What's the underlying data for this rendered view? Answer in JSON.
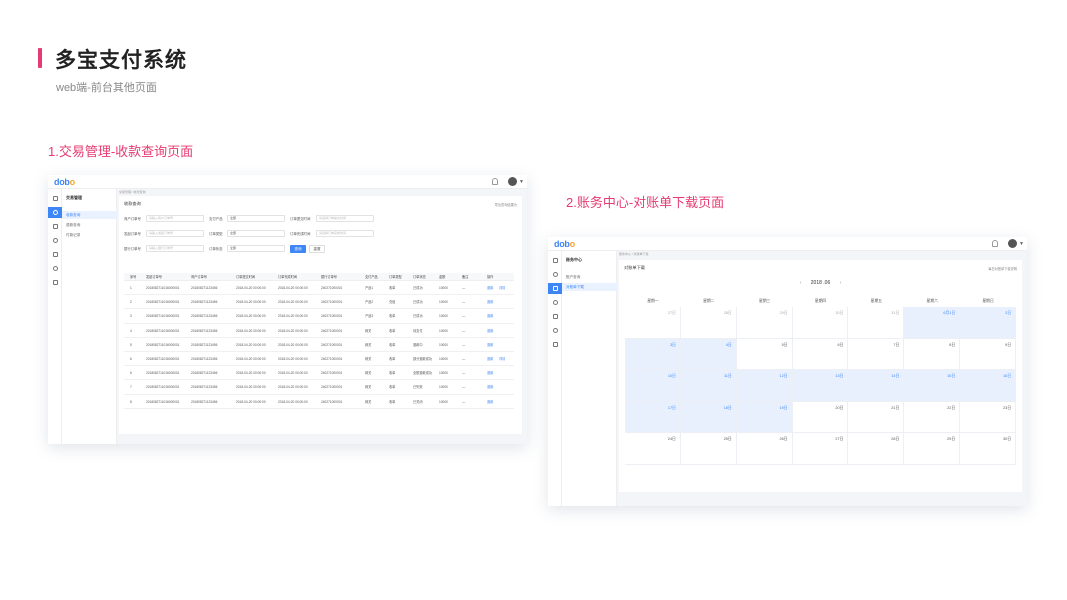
{
  "page": {
    "title": "多宝支付系统",
    "subtitle": "web端-前台其他页面",
    "accent_color": "#e63b72",
    "brand_color": "#3e86f5"
  },
  "section1": {
    "title": "1.交易管理-收款查询页面",
    "logo": {
      "main": "dob",
      "accent": "o"
    },
    "icons": [
      "home-icon",
      "transaction-icon",
      "file-icon",
      "user-icon",
      "settings-icon",
      "shield-icon",
      "share-icon"
    ],
    "subnav": {
      "title": "交易管理",
      "items": [
        "收款查询",
        "退款查询",
        "付款记录"
      ]
    },
    "breadcrumb": "交易管理 / 收款查询",
    "card_title": "收款查询",
    "export_link": "导出查询结果为",
    "form": {
      "row1": [
        {
          "label": "商户订单号",
          "placeholder": "请输入商户订单号"
        },
        {
          "label": "支付产品",
          "value": "全部"
        },
        {
          "label": "订单提交时间",
          "placeholder": "请选择订单提交时间"
        }
      ],
      "row2": [
        {
          "label": "发起订单号",
          "placeholder": "请输入发起订单号"
        },
        {
          "label": "订单类型",
          "value": "全部"
        },
        {
          "label": "订单完成时间",
          "placeholder": "请选择订单完成时间"
        }
      ],
      "row3": [
        {
          "label": "银行订单号",
          "placeholder": "请输入银行订单号"
        },
        {
          "label": "订单状态",
          "value": "全部"
        }
      ],
      "search_label": "查询",
      "reset_label": "重置"
    },
    "table": {
      "headers": [
        "序号",
        "发起订单号",
        "商户订单号",
        "订单提交时间",
        "订单完成时间",
        "银行订单号",
        "支付产品",
        "订单类型",
        "订单状态",
        "金额",
        "备注",
        "操作"
      ],
      "rows": [
        {
          "no": "1",
          "req": "2018082711016000001",
          "mch": "201808271123456",
          "submit": "2018-04-20 00:00:00",
          "done": "2018-04-20 00:00:00",
          "bank": "240271000001",
          "product": "产品1",
          "type": "收单",
          "status": "已成功",
          "amount": "10000",
          "note": "—",
          "ops": [
            "退款",
            "详情"
          ]
        },
        {
          "no": "2",
          "req": "2018082711016000001",
          "mch": "201808271123456",
          "submit": "2018-04-20 00:00:00",
          "done": "2018-04-20 00:00:00",
          "bank": "240271000001",
          "product": "产品2",
          "type": "充值",
          "status": "已成功",
          "amount": "10000",
          "note": "—",
          "ops": [
            "退款"
          ]
        },
        {
          "no": "3",
          "req": "2018082711016000001",
          "mch": "201808271123456",
          "submit": "2018-04-20 00:00:00",
          "done": "2018-04-20 00:00:00",
          "bank": "240271000001",
          "product": "产品3",
          "type": "收单",
          "status": "已成功",
          "amount": "10000",
          "note": "—",
          "ops": [
            "退款"
          ]
        },
        {
          "no": "4",
          "req": "2018082711016000001",
          "mch": "201808271123456",
          "submit": "2018-04-20 00:00:00",
          "done": "2018-04-20 00:00:00",
          "bank": "240271000001",
          "product": "网关",
          "type": "收单",
          "status": "待支付",
          "amount": "10000",
          "note": "—",
          "ops": [
            "退款"
          ]
        },
        {
          "no": "5",
          "req": "2018082711016000001",
          "mch": "201808271123456",
          "submit": "2018-04-20 00:00:00",
          "done": "2018-04-20 00:00:00",
          "bank": "240271000001",
          "product": "网关",
          "type": "收单",
          "status": "退款中",
          "amount": "10000",
          "note": "—",
          "ops": [
            "退款"
          ]
        },
        {
          "no": "6",
          "req": "2018082711016000001",
          "mch": "201808271123456",
          "submit": "2018-04-20 00:00:00",
          "done": "2018-04-20 00:00:00",
          "bank": "240271000001",
          "product": "网关",
          "type": "收单",
          "status": "部分退款成功",
          "amount": "10000",
          "note": "—",
          "ops": [
            "退款",
            "详情"
          ]
        },
        {
          "no": "6",
          "req": "2018082711016000001",
          "mch": "201808271123456",
          "submit": "2018-04-20 00:00:00",
          "done": "2018-04-20 00:00:00",
          "bank": "240271000001",
          "product": "网关",
          "type": "收单",
          "status": "全额退款成功",
          "amount": "10000",
          "note": "—",
          "ops": [
            "退款"
          ]
        },
        {
          "no": "7",
          "req": "2018082711016000001",
          "mch": "201808271123456",
          "submit": "2018-04-20 00:00:00",
          "done": "2018-04-20 00:00:00",
          "bank": "240271000001",
          "product": "网关",
          "type": "收单",
          "status": "已失败",
          "amount": "10000",
          "note": "—",
          "ops": [
            "退款"
          ]
        },
        {
          "no": "8",
          "req": "2018082711016000001",
          "mch": "201808271123456",
          "submit": "2018-04-20 00:00:00",
          "done": "2018-04-20 00:00:00",
          "bank": "240271000001",
          "product": "网关",
          "type": "收单",
          "status": "已关闭",
          "amount": "10000",
          "note": "—",
          "ops": [
            "退款"
          ]
        }
      ]
    }
  },
  "section2": {
    "title": "2.账务中心-对账单下载页面",
    "logo": {
      "main": "dob",
      "accent": "o"
    },
    "icons": [
      "home-icon",
      "transaction-icon",
      "file-icon",
      "user-icon",
      "settings-icon",
      "shield-icon",
      "share-icon"
    ],
    "subnav": {
      "title": "账务中心",
      "items": [
        "账户查询",
        "对账单下载"
      ]
    },
    "breadcrumb": "账务中心 / 对账单下载",
    "card_title": "对账单下载",
    "download_link": "每日对账单下载说明",
    "month": "2018 .06",
    "prev": "‹",
    "next": "›",
    "weekdays": [
      "星期一",
      "星期二",
      "星期三",
      "星期四",
      "星期五",
      "星期六",
      "星期日"
    ],
    "days": [
      {
        "label": "27日",
        "muted": true
      },
      {
        "label": "28日",
        "muted": true
      },
      {
        "label": "29日",
        "muted": true
      },
      {
        "label": "30日",
        "muted": true
      },
      {
        "label": "31日",
        "muted": true
      },
      {
        "label": "6月1日",
        "hl": true
      },
      {
        "label": "2日",
        "hl": true
      },
      {
        "label": "3日",
        "hl": true
      },
      {
        "label": "4日",
        "hl": true
      },
      {
        "label": "5日"
      },
      {
        "label": "6日"
      },
      {
        "label": "7日"
      },
      {
        "label": "8日"
      },
      {
        "label": "9日"
      },
      {
        "label": "10日",
        "hl": true
      },
      {
        "label": "11日",
        "hl": true
      },
      {
        "label": "12日",
        "hl": true
      },
      {
        "label": "13日",
        "hl": true
      },
      {
        "label": "14日",
        "hl": true
      },
      {
        "label": "15日",
        "hl": true
      },
      {
        "label": "16日",
        "hl": true
      },
      {
        "label": "17日",
        "hl": true
      },
      {
        "label": "18日",
        "hl": true
      },
      {
        "label": "19日",
        "hl": true
      },
      {
        "label": "20日"
      },
      {
        "label": "21日"
      },
      {
        "label": "22日"
      },
      {
        "label": "23日"
      },
      {
        "label": "24日"
      },
      {
        "label": "25日"
      },
      {
        "label": "26日"
      },
      {
        "label": "27日"
      },
      {
        "label": "28日"
      },
      {
        "label": "29日"
      },
      {
        "label": "30日"
      }
    ]
  }
}
